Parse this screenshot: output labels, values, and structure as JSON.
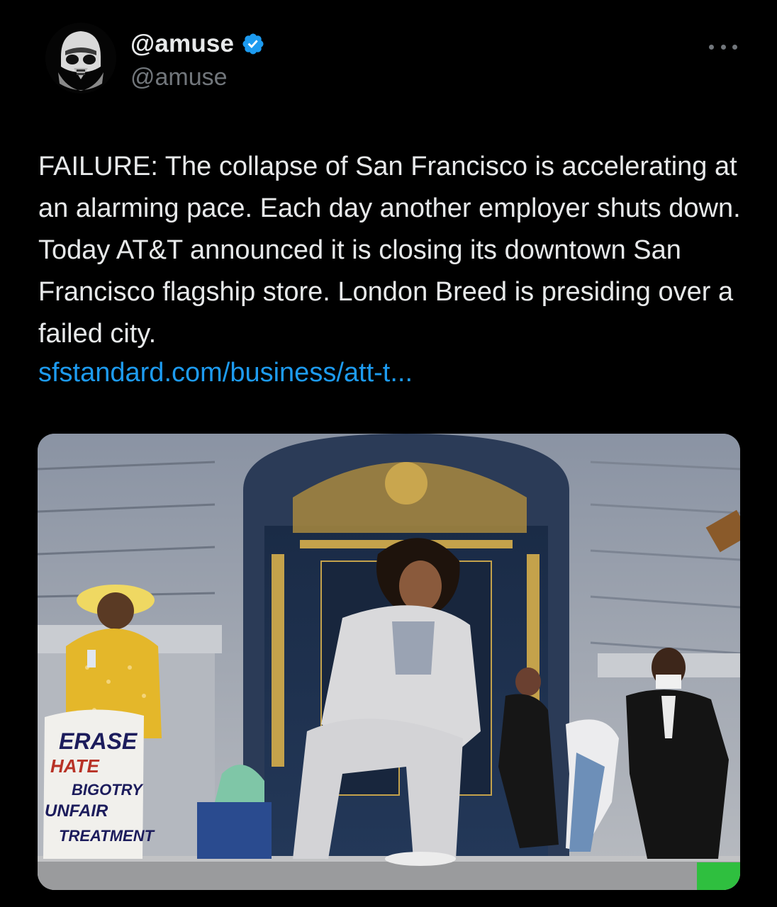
{
  "author": {
    "display_name": "@amuse",
    "handle": "@amuse",
    "verified": true,
    "avatar_icon": "stormtrooper-avatar-icon"
  },
  "menu": {
    "icon": "more-horizontal-icon"
  },
  "tweet": {
    "text": "FAILURE: The collapse of San Francisco is accelerating at an alarming pace. Each day another employer shuts down. Today AT&T announced it is closing its downtown San Francisco flagship store. London Breed is presiding over a failed city.",
    "link": "sfstandard.com/business/att-t..."
  },
  "media": {
    "sign_text": [
      "ERASE",
      "HATE",
      "BIGOTRY",
      "UNFAIR",
      "TREATMENT"
    ]
  },
  "colors": {
    "background": "#000000",
    "text": "#e7e9ea",
    "secondary": "#71767b",
    "link": "#1d9bf0",
    "verified": "#1d9bf0"
  }
}
